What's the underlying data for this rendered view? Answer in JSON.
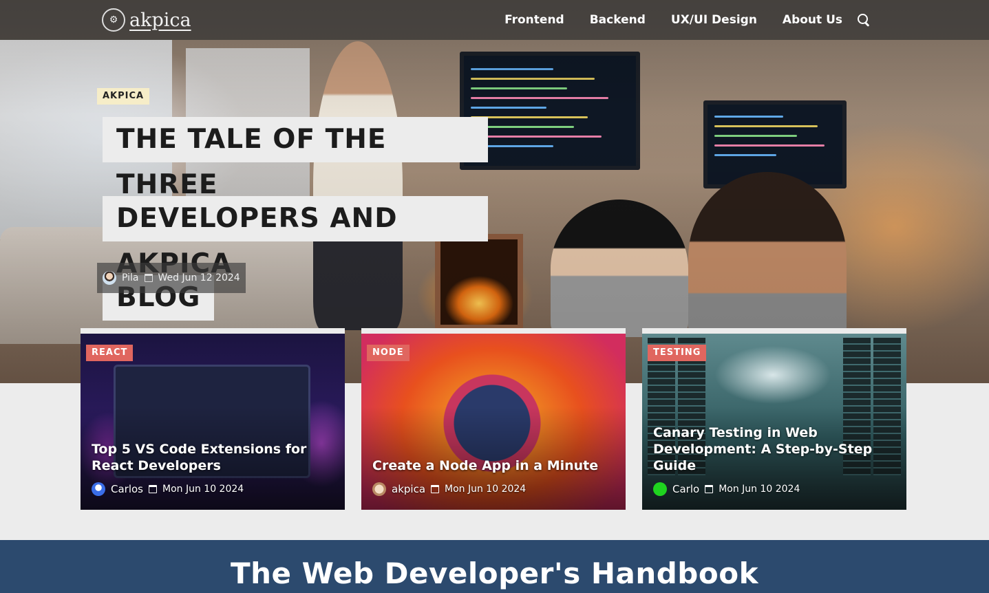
{
  "nav": {
    "logo_text": "akpica",
    "logo_mark": "⚙",
    "links": [
      "Frontend",
      "Backend",
      "UX/UI Design",
      "About Us"
    ],
    "search_icon": "search-icon"
  },
  "hero": {
    "tag": "AKPICA",
    "title_lines": [
      "THE TALE OF THE THREE",
      "DEVELOPERS AND AKPICA",
      "BLOG"
    ],
    "author": "Pila",
    "date": "Wed Jun 12 2024"
  },
  "cards": [
    {
      "tag": "REACT",
      "title": "Top 5 VS Code Extensions for React Developers",
      "author": "Carlos",
      "date": "Mon Jun 10 2024"
    },
    {
      "tag": "NODE",
      "title": "Create a Node App in a Minute",
      "author": "akpica",
      "date": "Mon Jun 10 2024"
    },
    {
      "tag": "TESTING",
      "title": "Canary Testing in Web Development: A Step-by-Step Guide",
      "author": "Carlo",
      "date": "Mon Jun 10 2024"
    }
  ],
  "banner": {
    "title": "The Web Developer's Handbook"
  },
  "colors": {
    "nav_bg": "#323232",
    "tag_hero_bg": "#f6edc8",
    "card_tag_bg": "#e0665f",
    "banner_bg": "#2c4a6e",
    "page_bg": "#ececec"
  }
}
